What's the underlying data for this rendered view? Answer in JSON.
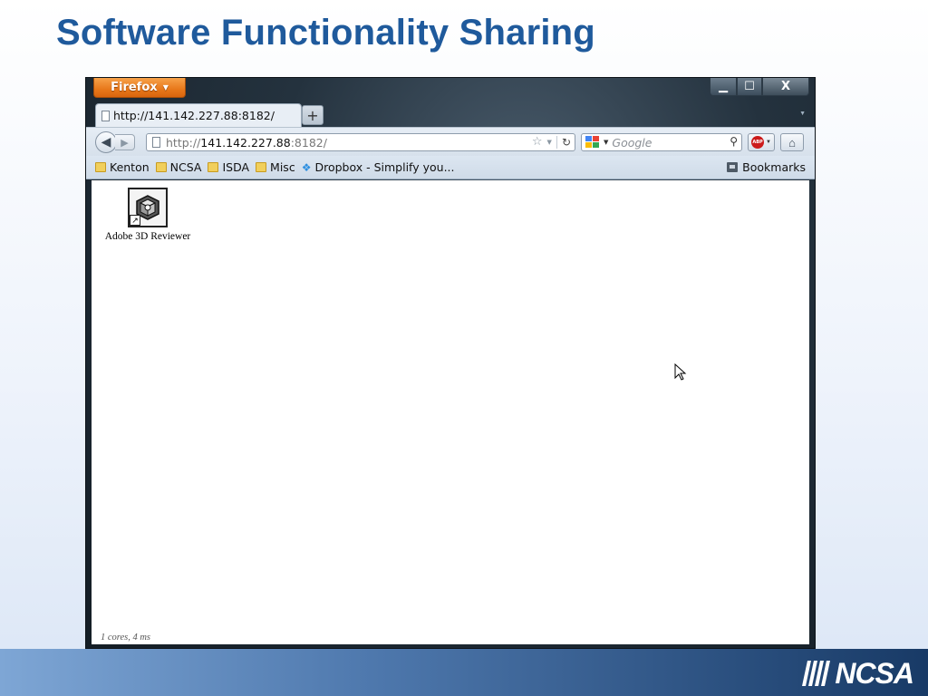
{
  "slide": {
    "title": "Software Functionality Sharing",
    "logo_text": "NCSA"
  },
  "browser": {
    "app_button": "Firefox",
    "tab": {
      "title": "http://141.142.227.88:8182/"
    },
    "newtab_symbol": "+",
    "window_controls": {
      "minimize": "▁",
      "maximize": "☐",
      "close": "X"
    },
    "address": {
      "scheme": "http://",
      "host": "141.142.227.88",
      "port_path": ":8182/"
    },
    "search": {
      "placeholder": "Google"
    },
    "bookmarks": [
      {
        "label": "Kenton",
        "icon": "folder-icon"
      },
      {
        "label": "NCSA",
        "icon": "folder-icon"
      },
      {
        "label": "ISDA",
        "icon": "folder-icon"
      },
      {
        "label": "Misc",
        "icon": "folder-icon"
      },
      {
        "label": "Dropbox - Simplify you...",
        "icon": "dropbox-icon"
      }
    ],
    "bookmarks_menu": "Bookmarks"
  },
  "page": {
    "desktop_icon": {
      "label": "Adobe 3D Reviewer"
    },
    "status": "1 cores, 4 ms"
  }
}
